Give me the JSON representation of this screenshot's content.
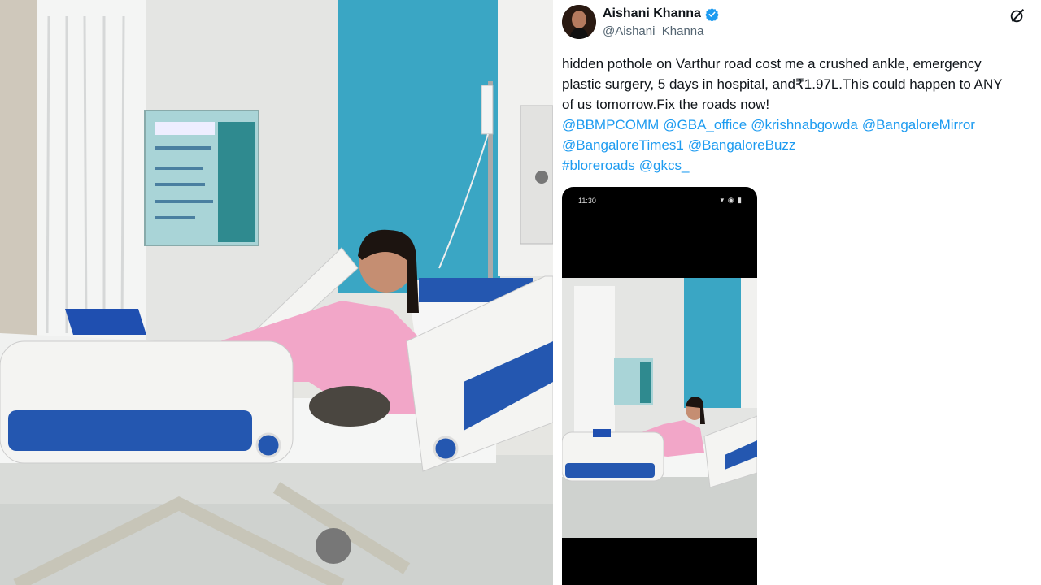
{
  "tweet": {
    "display_name": "Aishani Khanna",
    "handle": "@Aishani_Khanna",
    "body_lines": [
      "hidden pothole on Varthur road cost me a crushed ankle, emergency",
      "plastic surgery, 5 days in hospital, and₹1.97L.This could happen to ANY",
      "of us tomorrow.Fix the roads now!"
    ],
    "mentions_line1": [
      "@BBMPCOMM",
      "@GBA_office",
      "@krishnabgowda",
      "@BangaloreMirror"
    ],
    "mentions_line2": [
      "@BangaloreTimes1",
      "@BangaloreBuzz"
    ],
    "mentions_line3": [
      "#bloreroads",
      "@gkcs_"
    ],
    "verified_icon": "verified-badge-icon",
    "grok_icon": "grok-icon"
  },
  "phone_status": {
    "time": "11:30",
    "icons": "▾ ◉ ▮"
  },
  "colors": {
    "link": "#1d9bf0",
    "text": "#0f1419",
    "secondary": "#536471",
    "wall_teal": "#3aa6c4",
    "bed_blue": "#2457b0",
    "gown_pink": "#f2a6c8"
  }
}
